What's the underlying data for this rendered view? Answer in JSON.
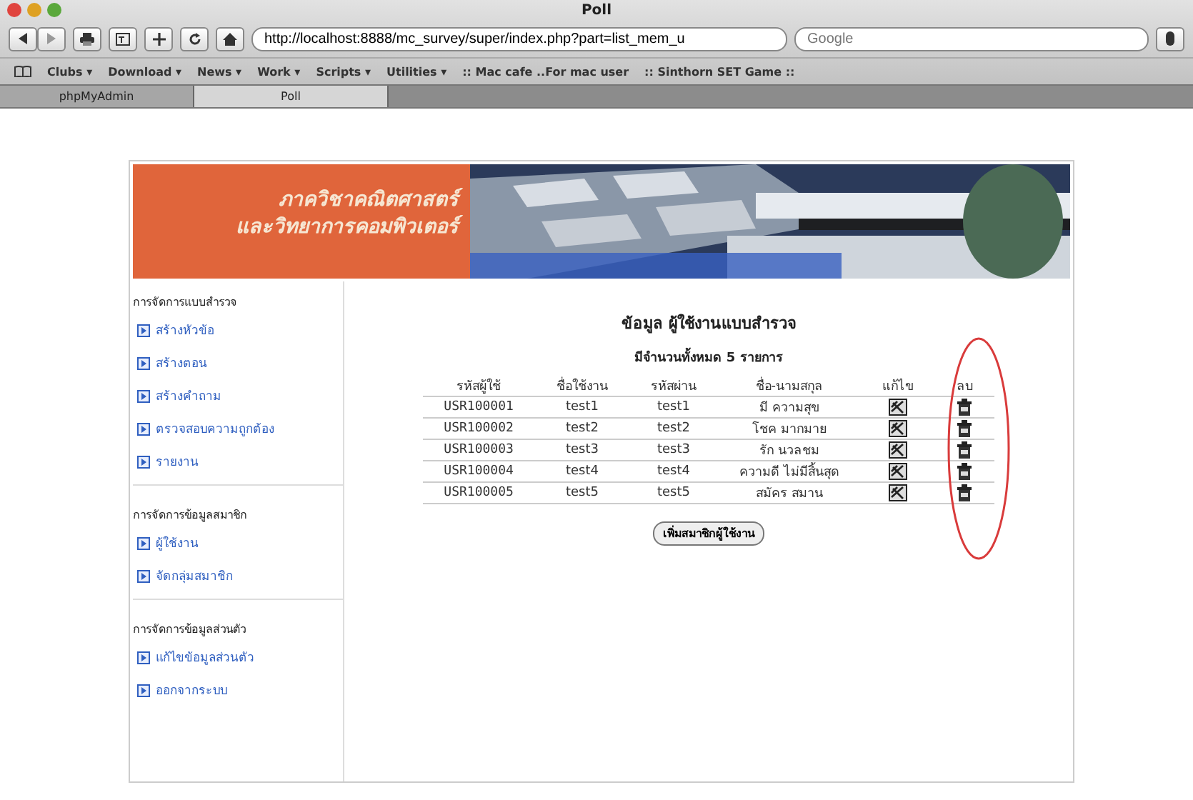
{
  "window": {
    "title": "Poll"
  },
  "toolbar": {
    "url": "http://localhost:8888/mc_survey/super/index.php?part=list_mem_u",
    "search": {
      "placeholder": "Google"
    }
  },
  "bookmarks": [
    "Clubs ▾",
    "Download ▾",
    "News ▾",
    "Work ▾",
    "Scripts ▾",
    "Utilities ▾",
    ":: Mac cafe ..For mac user",
    ":: Sinthorn SET Game ::"
  ],
  "tabs": [
    {
      "label": "phpMyAdmin",
      "selected": false
    },
    {
      "label": "Poll",
      "selected": true
    }
  ],
  "banner": {
    "lines": [
      "ภาควิชาคณิตศาสตร์",
      "และวิทยาการคอมพิวเตอร์"
    ]
  },
  "sidebar": [
    {
      "heading": "การจัดการแบบสำรวจ",
      "items": [
        "สร้างหัวข้อ",
        "สร้างตอน",
        "สร้างคำถาม",
        "ตรวจสอบความถูกต้อง",
        "รายงาน"
      ]
    },
    {
      "heading": "การจัดการข้อมูลสมาชิก",
      "items": [
        "ผู้ใช้งาน",
        "จัดกลุ่มสมาชิก"
      ]
    },
    {
      "heading": "การจัดการข้อมูลส่วนตัว",
      "items": [
        "แก้ไขข้อมูลส่วนตัว",
        "ออกจากระบบ"
      ]
    }
  ],
  "main": {
    "title": "ข้อมูล ผู้ใช้งานแบบสำรวจ",
    "count": "มีจำนวนทั้งหมด 5 รายการ",
    "columns": [
      "รหัสผู้ใช้",
      "ชื่อใช้งาน",
      "รหัสผ่าน",
      "ชื่อ-นามสกุล",
      "แก้ไข",
      "ลบ"
    ],
    "rows": [
      [
        "USR100001",
        "test1",
        "test1",
        "มี ความสุข"
      ],
      [
        "USR100002",
        "test2",
        "test2",
        "โชค มากมาย"
      ],
      [
        "USR100003",
        "test3",
        "test3",
        "รัก นวลชม"
      ],
      [
        "USR100004",
        "test4",
        "test4",
        "ความดี ไม่มีสิ้นสุด"
      ],
      [
        "USR100005",
        "test5",
        "test5",
        "สมัคร สมาน"
      ]
    ],
    "add_button": "เพิ่มสมาชิกผู้ใช้งาน"
  }
}
